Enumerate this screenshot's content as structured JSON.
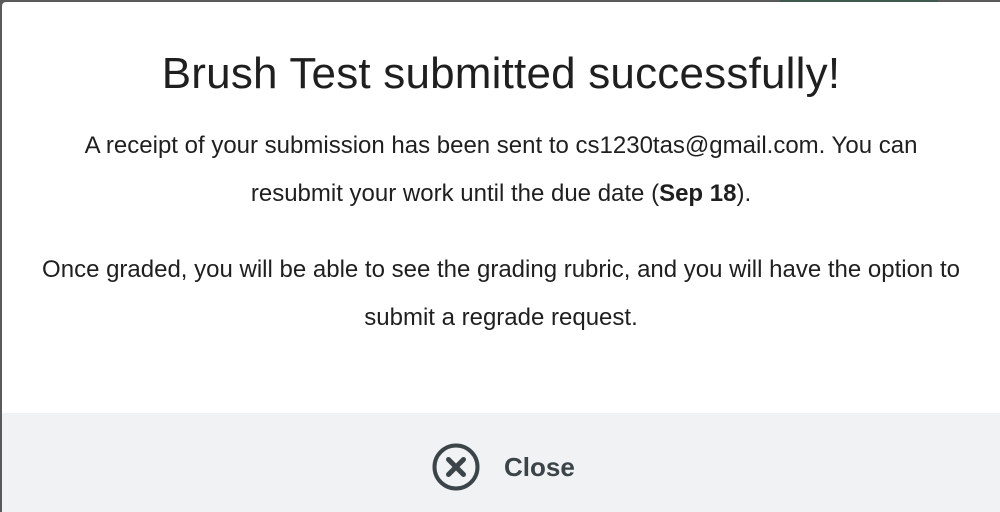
{
  "dialog": {
    "title": "Brush Test submitted successfully!",
    "receipt_text_before": "A receipt of your submission has been sent to cs1230tas@gmail.com. You can resubmit your work until the due date (",
    "due_date": "Sep 18",
    "receipt_text_after": ").",
    "graded_text": "Once graded, you will be able to see the grading rubric, and you will have the option to submit a regrade request."
  },
  "footer": {
    "close_label": "Close",
    "close_icon": "circle-x-icon"
  },
  "colors": {
    "footer_bg": "#f1f2f4",
    "close_color": "#3b4448",
    "text": "#1f1f1f"
  }
}
